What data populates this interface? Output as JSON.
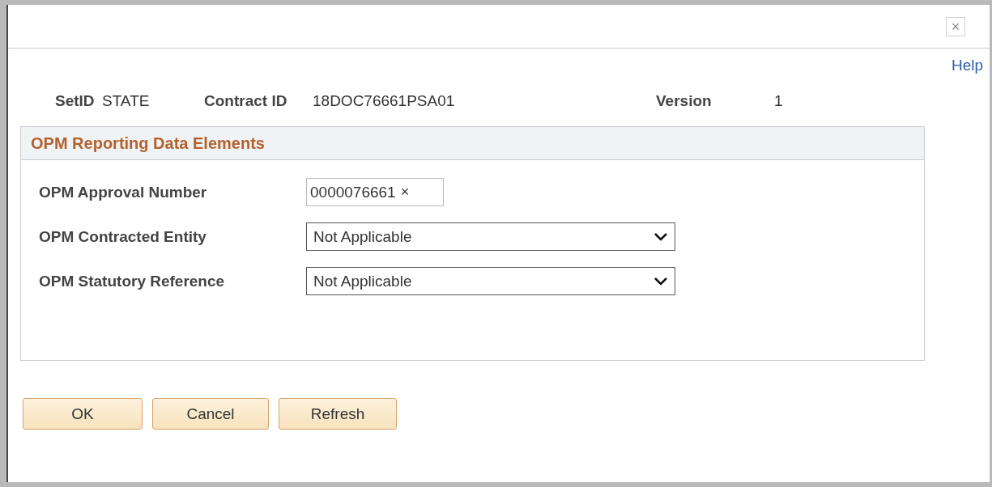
{
  "window": {
    "close": "×",
    "help": "Help"
  },
  "header": [
    {
      "label": "SetID",
      "value": "STATE"
    },
    {
      "label": "Contract ID",
      "value": "18DOC76661PSA01"
    },
    {
      "label": "Version",
      "value": "1"
    }
  ],
  "section": {
    "title": "OPM Reporting Data Elements",
    "fields": [
      {
        "kind": "text",
        "label": "OPM Approval Number",
        "value": "0000076661",
        "clear": "×"
      },
      {
        "kind": "select",
        "label": "OPM Contracted Entity",
        "value": "Not Applicable"
      },
      {
        "kind": "select",
        "label": "OPM Statutory Reference",
        "value": "Not Applicable"
      }
    ]
  },
  "buttons": [
    "OK",
    "Cancel",
    "Refresh"
  ]
}
